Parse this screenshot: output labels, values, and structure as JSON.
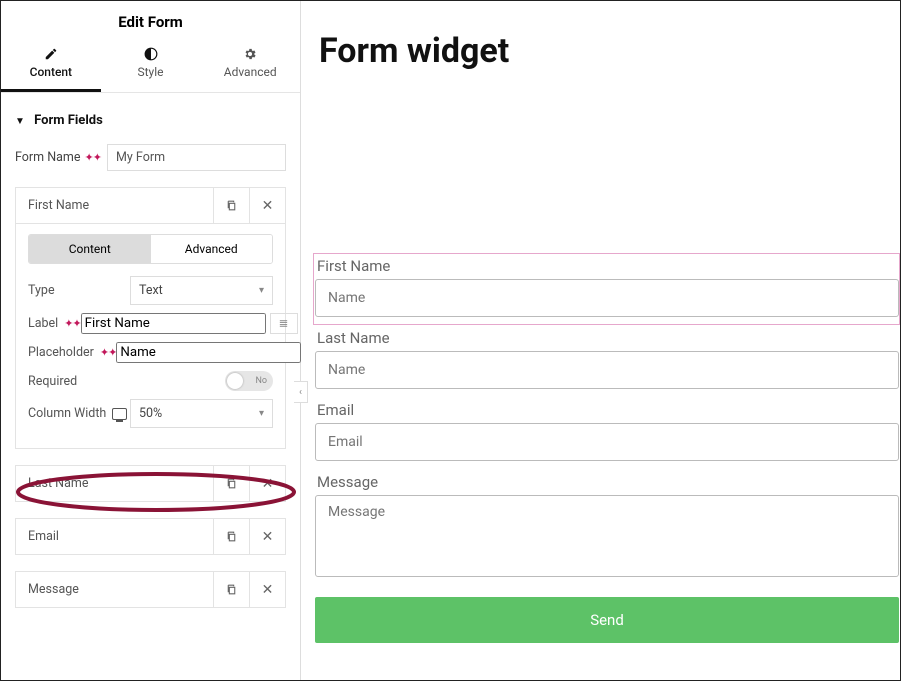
{
  "panel": {
    "title": "Edit Form",
    "tabs": {
      "content": "Content",
      "style": "Style",
      "advanced": "Advanced"
    }
  },
  "section": {
    "title": "Form Fields"
  },
  "formName": {
    "label": "Form Name",
    "value": "My Form"
  },
  "fieldDetail": {
    "innerTabs": {
      "content": "Content",
      "advanced": "Advanced"
    },
    "type": {
      "label": "Type",
      "value": "Text"
    },
    "labelRow": {
      "label": "Label",
      "value": "First Name"
    },
    "placeholder": {
      "label": "Placeholder",
      "value": "Name"
    },
    "required": {
      "label": "Required",
      "value": "No"
    },
    "columnWidth": {
      "label": "Column Width",
      "value": "50%"
    }
  },
  "fields": [
    {
      "name": "First Name"
    },
    {
      "name": "Last Name"
    },
    {
      "name": "Email"
    },
    {
      "name": "Message"
    }
  ],
  "preview": {
    "heading": "Form widget",
    "items": [
      {
        "label": "First Name",
        "placeholder": "Name"
      },
      {
        "label": "Last Name",
        "placeholder": "Name"
      },
      {
        "label": "Email",
        "placeholder": "Email"
      },
      {
        "label": "Message",
        "placeholder": "Message"
      }
    ],
    "submit": "Send"
  }
}
